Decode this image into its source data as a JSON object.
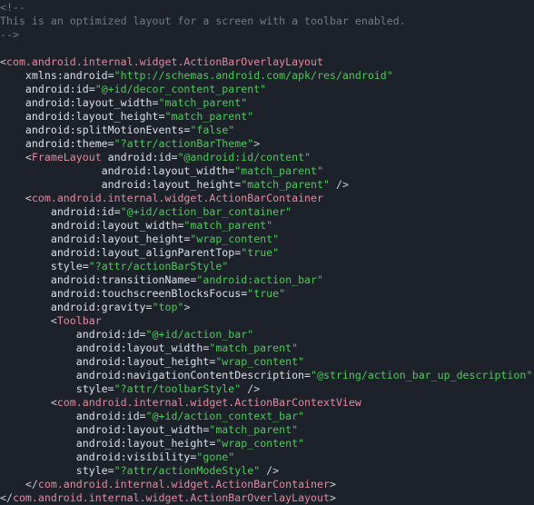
{
  "editor": {
    "kind": "xml-source-view",
    "background_color": "#1d2129",
    "colors": {
      "comment": "#6f7b87",
      "tag": "#e08ba1",
      "punctuation": "#c9d1d9",
      "attribute": "#dbe1e8",
      "value": "#4ec95c"
    },
    "language": "XML",
    "font_size_px": 11.6,
    "line_height_px": 15
  },
  "code": {
    "lines": [
      {
        "n": 1,
        "tokens": [
          {
            "c": "comment",
            "s": "<!--"
          }
        ]
      },
      {
        "n": 2,
        "tokens": [
          {
            "c": "comment",
            "s": "This is an optimized layout for a screen with a toolbar enabled."
          }
        ]
      },
      {
        "n": 3,
        "tokens": [
          {
            "c": "comment",
            "s": "-->"
          }
        ]
      },
      {
        "n": 4,
        "tokens": []
      },
      {
        "n": 5,
        "tokens": [
          {
            "c": "punctuation",
            "s": "<"
          },
          {
            "c": "tag",
            "s": "com.android.internal.widget.ActionBarOverlayLayout"
          }
        ]
      },
      {
        "n": 6,
        "tokens": [
          {
            "c": "attribute",
            "s": "    xmlns:android="
          },
          {
            "c": "value",
            "s": "\"http://schemas.android.com/apk/res/android\""
          }
        ]
      },
      {
        "n": 7,
        "tokens": [
          {
            "c": "attribute",
            "s": "    android:id="
          },
          {
            "c": "value",
            "s": "\"@+id/decor_content_parent\""
          }
        ]
      },
      {
        "n": 8,
        "tokens": [
          {
            "c": "attribute",
            "s": "    android:layout_width="
          },
          {
            "c": "value",
            "s": "\"match_parent\""
          }
        ]
      },
      {
        "n": 9,
        "tokens": [
          {
            "c": "attribute",
            "s": "    android:layout_height="
          },
          {
            "c": "value",
            "s": "\"match_parent\""
          }
        ]
      },
      {
        "n": 10,
        "tokens": [
          {
            "c": "attribute",
            "s": "    android:splitMotionEvents="
          },
          {
            "c": "value",
            "s": "\"false\""
          }
        ]
      },
      {
        "n": 11,
        "tokens": [
          {
            "c": "attribute",
            "s": "    android:theme="
          },
          {
            "c": "value",
            "s": "\"?attr/actionBarTheme\""
          },
          {
            "c": "punctuation",
            "s": ">"
          }
        ]
      },
      {
        "n": 12,
        "tokens": [
          {
            "c": "punctuation",
            "s": "    <"
          },
          {
            "c": "tag",
            "s": "FrameLayout"
          },
          {
            "c": "attribute",
            "s": " android:id="
          },
          {
            "c": "value",
            "s": "\"@android:id/content\""
          }
        ]
      },
      {
        "n": 13,
        "tokens": [
          {
            "c": "attribute",
            "s": "                android:layout_width="
          },
          {
            "c": "value",
            "s": "\"match_parent\""
          }
        ]
      },
      {
        "n": 14,
        "tokens": [
          {
            "c": "attribute",
            "s": "                android:layout_height="
          },
          {
            "c": "value",
            "s": "\"match_parent\""
          },
          {
            "c": "punctuation",
            "s": " />"
          }
        ]
      },
      {
        "n": 15,
        "tokens": [
          {
            "c": "punctuation",
            "s": "    <"
          },
          {
            "c": "tag",
            "s": "com.android.internal.widget.ActionBarContainer"
          }
        ]
      },
      {
        "n": 16,
        "tokens": [
          {
            "c": "attribute",
            "s": "        android:id="
          },
          {
            "c": "value",
            "s": "\"@+id/action_bar_container\""
          }
        ]
      },
      {
        "n": 17,
        "tokens": [
          {
            "c": "attribute",
            "s": "        android:layout_width="
          },
          {
            "c": "value",
            "s": "\"match_parent\""
          }
        ]
      },
      {
        "n": 18,
        "tokens": [
          {
            "c": "attribute",
            "s": "        android:layout_height="
          },
          {
            "c": "value",
            "s": "\"wrap_content\""
          }
        ]
      },
      {
        "n": 19,
        "tokens": [
          {
            "c": "attribute",
            "s": "        android:layout_alignParentTop="
          },
          {
            "c": "value",
            "s": "\"true\""
          }
        ]
      },
      {
        "n": 20,
        "tokens": [
          {
            "c": "attribute",
            "s": "        style="
          },
          {
            "c": "value",
            "s": "\"?attr/actionBarStyle\""
          }
        ]
      },
      {
        "n": 21,
        "tokens": [
          {
            "c": "attribute",
            "s": "        android:transitionName="
          },
          {
            "c": "value",
            "s": "\"android:action_bar\""
          }
        ]
      },
      {
        "n": 22,
        "tokens": [
          {
            "c": "attribute",
            "s": "        android:touchscreenBlocksFocus="
          },
          {
            "c": "value",
            "s": "\"true\""
          }
        ]
      },
      {
        "n": 23,
        "tokens": [
          {
            "c": "attribute",
            "s": "        android:gravity="
          },
          {
            "c": "value",
            "s": "\"top\""
          },
          {
            "c": "punctuation",
            "s": ">"
          }
        ]
      },
      {
        "n": 24,
        "tokens": [
          {
            "c": "punctuation",
            "s": "        <"
          },
          {
            "c": "tag",
            "s": "Toolbar"
          }
        ]
      },
      {
        "n": 25,
        "tokens": [
          {
            "c": "attribute",
            "s": "            android:id="
          },
          {
            "c": "value",
            "s": "\"@+id/action_bar\""
          }
        ]
      },
      {
        "n": 26,
        "tokens": [
          {
            "c": "attribute",
            "s": "            android:layout_width="
          },
          {
            "c": "value",
            "s": "\"match_parent\""
          }
        ]
      },
      {
        "n": 27,
        "tokens": [
          {
            "c": "attribute",
            "s": "            android:layout_height="
          },
          {
            "c": "value",
            "s": "\"wrap_content\""
          }
        ]
      },
      {
        "n": 28,
        "tokens": [
          {
            "c": "attribute",
            "s": "            android:navigationContentDescription="
          },
          {
            "c": "value",
            "s": "\"@string/action_bar_up_description\""
          }
        ]
      },
      {
        "n": 29,
        "tokens": [
          {
            "c": "attribute",
            "s": "            style="
          },
          {
            "c": "value",
            "s": "\"?attr/toolbarStyle\""
          },
          {
            "c": "punctuation",
            "s": " />"
          }
        ]
      },
      {
        "n": 30,
        "tokens": [
          {
            "c": "punctuation",
            "s": "        <"
          },
          {
            "c": "tag",
            "s": "com.android.internal.widget.ActionBarContextView"
          }
        ]
      },
      {
        "n": 31,
        "tokens": [
          {
            "c": "attribute",
            "s": "            android:id="
          },
          {
            "c": "value",
            "s": "\"@+id/action_context_bar\""
          }
        ]
      },
      {
        "n": 32,
        "tokens": [
          {
            "c": "attribute",
            "s": "            android:layout_width="
          },
          {
            "c": "value",
            "s": "\"match_parent\""
          }
        ]
      },
      {
        "n": 33,
        "tokens": [
          {
            "c": "attribute",
            "s": "            android:layout_height="
          },
          {
            "c": "value",
            "s": "\"wrap_content\""
          }
        ]
      },
      {
        "n": 34,
        "tokens": [
          {
            "c": "attribute",
            "s": "            android:visibility="
          },
          {
            "c": "value",
            "s": "\"gone\""
          }
        ]
      },
      {
        "n": 35,
        "tokens": [
          {
            "c": "attribute",
            "s": "            style="
          },
          {
            "c": "value",
            "s": "\"?attr/actionModeStyle\""
          },
          {
            "c": "punctuation",
            "s": " />"
          }
        ]
      },
      {
        "n": 36,
        "tokens": [
          {
            "c": "punctuation",
            "s": "    </"
          },
          {
            "c": "tag",
            "s": "com.android.internal.widget.ActionBarContainer"
          },
          {
            "c": "punctuation",
            "s": ">"
          }
        ]
      },
      {
        "n": 37,
        "tokens": [
          {
            "c": "punctuation",
            "s": "</"
          },
          {
            "c": "tag",
            "s": "com.android.internal.widget.ActionBarOverlayLayout"
          },
          {
            "c": "punctuation",
            "s": ">"
          }
        ]
      }
    ]
  }
}
